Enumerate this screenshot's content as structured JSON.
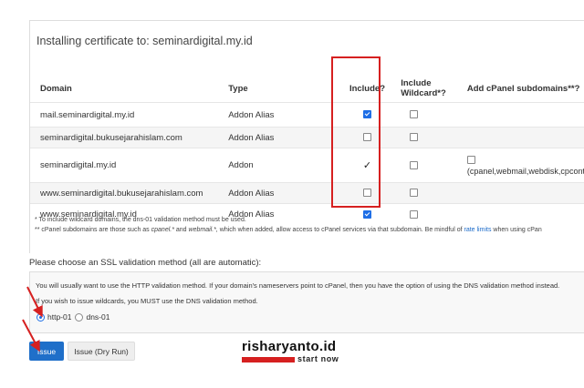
{
  "panel": {
    "title": "Installing certificate to: seminardigital.my.id"
  },
  "table": {
    "headers": {
      "domain": "Domain",
      "type": "Type",
      "include": "Include?",
      "wildcard": "Include Wildcard*?",
      "subdomains": "Add cPanel subdomains**?"
    },
    "rows": [
      {
        "domain": "mail.seminardigital.my.id",
        "type": "Addon Alias",
        "include": "checked",
        "wildcard": false,
        "sub": ""
      },
      {
        "domain": "seminardigital.bukusejarahislam.com",
        "type": "Addon Alias",
        "include": "unchecked",
        "wildcard": false,
        "sub": ""
      },
      {
        "domain": "seminardigital.my.id",
        "type": "Addon",
        "include": "tick",
        "wildcard": false,
        "sub": "(cpanel,webmail,webdisk,cpcont"
      },
      {
        "domain": "www.seminardigital.bukusejarahislam.com",
        "type": "Addon Alias",
        "include": "unchecked",
        "wildcard": false,
        "sub": ""
      },
      {
        "domain": "www.seminardigital.my.id",
        "type": "Addon Alias",
        "include": "checked",
        "wildcard": false,
        "sub": ""
      }
    ],
    "tick_glyph": "✓"
  },
  "notes": {
    "line1": "* To include wildcard domains, the dns-01 validation method must be used.",
    "line2_pre": "** cPanel subdomains are those such as",
    "line2_cpanel": "cpanel.*",
    "line2_and": "and",
    "line2_webmail": "webmail.*,",
    "line2_post": "which when added, allow access to cPanel services via that subdomain. Be mindful of",
    "line2_link": "rate limits",
    "line2_end": "when using cPan"
  },
  "ssl": {
    "prompt": "Please choose an SSL validation method (all are automatic):",
    "line1": "You will usually want to use the HTTP validation method. If your domain's nameservers point to cPanel, then you have the option of using the DNS validation method instead.",
    "line2": "If you wish to issue wildcards, you MUST use the DNS validation method.",
    "options": [
      {
        "label": "http-01",
        "selected": true
      },
      {
        "label": "dns-01",
        "selected": false
      }
    ]
  },
  "buttons": {
    "issue": "Issue",
    "dry_run": "Issue (Dry Run)"
  },
  "watermark": {
    "title": "risharyanto.id",
    "subtitle": "start now"
  },
  "colors": {
    "highlight": "#d62020",
    "primary": "#1f6fc9",
    "link": "#1b6ac9"
  }
}
